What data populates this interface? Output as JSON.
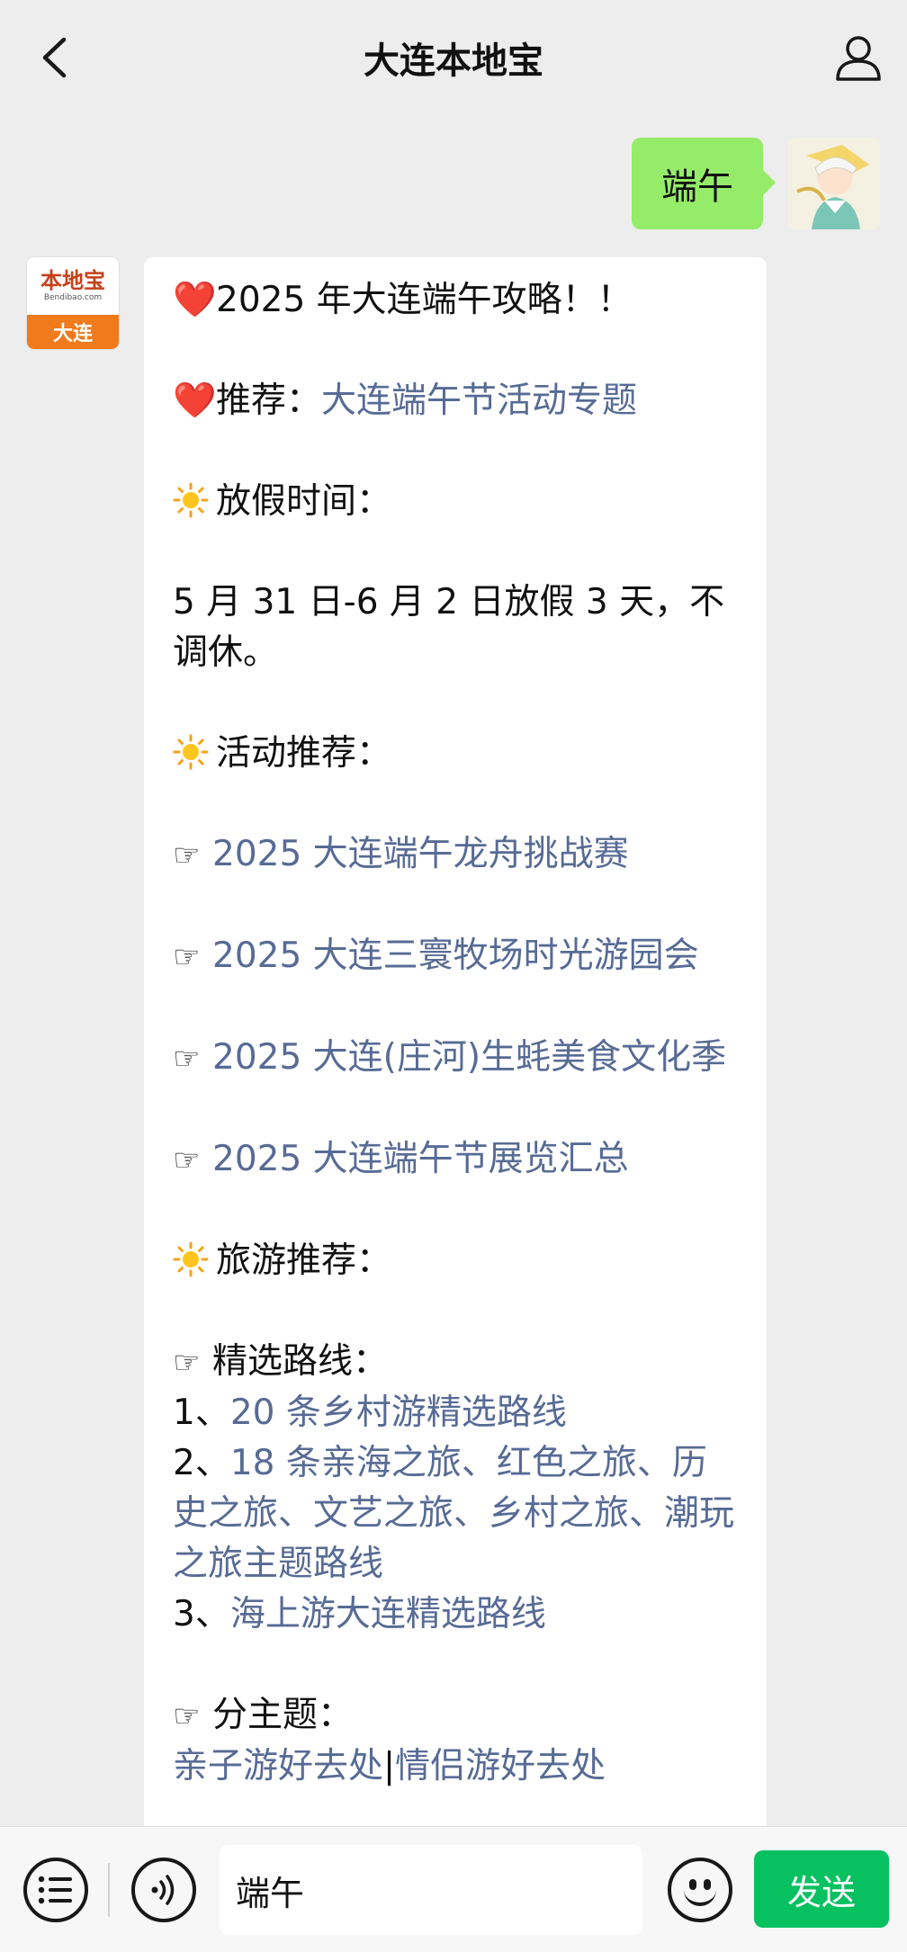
{
  "header": {
    "title": "大连本地宝",
    "back_icon": "chevron-left-icon",
    "profile_icon": "person-icon"
  },
  "user_message": {
    "text": "端午"
  },
  "bot_avatar": {
    "logo_text": "本地宝",
    "logo_url": "Bendibao.com",
    "city": "大连"
  },
  "bot_message": {
    "title_emoji": "❤️",
    "title": "2025 年大连端午攻略！！",
    "recommend_label": "推荐：",
    "recommend_link": "大连端午节活动专题",
    "holiday_heading": "放假时间：",
    "holiday_text": "5 月 31 日-6 月 2 日放假 3 天，不调休。",
    "activities_heading": "活动推荐：",
    "activities": [
      "2025 大连端午龙舟挑战赛",
      "2025 大连三寰牧场时光游园会",
      "2025 大连(庄河)生蚝美食文化季",
      "2025 大连端午节展览汇总"
    ],
    "travel_heading": "旅游推荐：",
    "routes_label": "精选路线：",
    "routes": [
      {
        "prefix": "1、",
        "link": "20 条乡村游精选路线"
      },
      {
        "prefix": "2、",
        "link": "18 条亲海之旅、红色之旅、历史之旅、文艺之旅、乡村之旅、潮玩之旅主题路线"
      },
      {
        "prefix": "3、",
        "link": "海上游大连精选路线"
      }
    ],
    "subtopic_label": "分主题：",
    "subtopic_links": [
      "亲子游好去处",
      "情侣游好去处"
    ],
    "subtopic_separator": "|"
  },
  "input_bar": {
    "value": "端午",
    "send_label": "发送"
  },
  "colors": {
    "background": "#ededed",
    "user_bubble": "#95ec69",
    "link": "#576b95",
    "send": "#07c160",
    "brand_orange": "#f07a1c"
  }
}
